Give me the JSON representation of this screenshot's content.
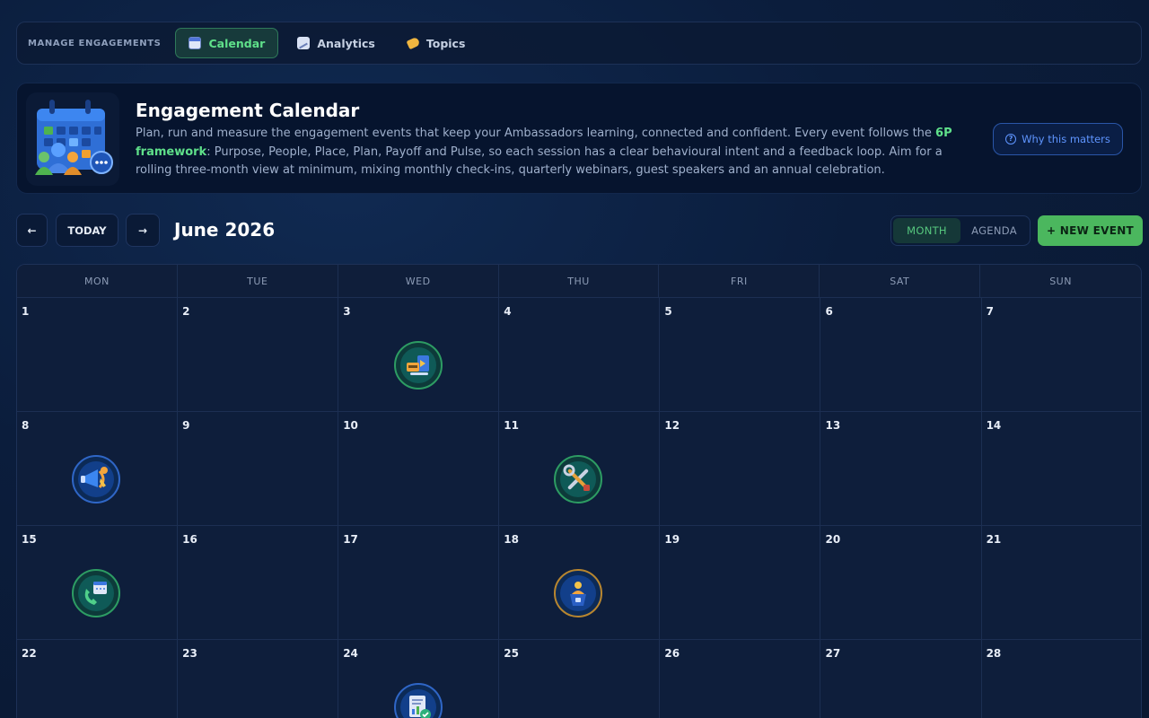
{
  "nav": {
    "title": "MANAGE ENGAGEMENTS",
    "tabs": [
      {
        "label": "Calendar",
        "icon": "calendar-icon",
        "active": true
      },
      {
        "label": "Analytics",
        "icon": "chart-icon",
        "active": false
      },
      {
        "label": "Topics",
        "icon": "tag-icon",
        "active": false
      }
    ]
  },
  "hero": {
    "title": "Engagement Calendar",
    "desc_before": "Plan, run and measure the engagement events that keep your Ambassadors learning, connected and confident. Every event follows the ",
    "desc_highlight": "6P framework",
    "desc_after": ": Purpose, People, Place, Plan, Payoff and Pulse, so each session has a clear behavioural intent and a feedback loop. Aim for a rolling three-month view at minimum, mixing monthly check-ins, quarterly webinars, guest speakers and an annual celebration.",
    "why_button": "Why this matters",
    "colors": {
      "highlight": "#5fe08a",
      "link": "#5f95ff"
    }
  },
  "controls": {
    "prev": "←",
    "today": "TODAY",
    "next": "→",
    "month_label": "June 2026",
    "views": [
      "MONTH",
      "AGENDA"
    ],
    "active_view": "MONTH",
    "new_event": "+ NEW EVENT"
  },
  "calendar": {
    "weekdays": [
      "MON",
      "TUE",
      "WED",
      "THU",
      "FRI",
      "SAT",
      "SUN"
    ],
    "weeks": [
      [
        "1",
        "2",
        "3",
        "4",
        "5",
        "6",
        "7"
      ],
      [
        "8",
        "9",
        "10",
        "11",
        "12",
        "13",
        "14"
      ],
      [
        "15",
        "16",
        "17",
        "18",
        "19",
        "20",
        "21"
      ],
      [
        "22",
        "23",
        "24",
        "25",
        "26",
        "27",
        "28"
      ]
    ],
    "events": [
      {
        "day": "3",
        "icon": "webinar-icon",
        "style": "green"
      },
      {
        "day": "8",
        "icon": "megaphone-icon",
        "style": "blue"
      },
      {
        "day": "11",
        "icon": "tools-icon",
        "style": "green"
      },
      {
        "day": "15",
        "icon": "phone-calendar-icon",
        "style": "green"
      },
      {
        "day": "18",
        "icon": "guest-speaker-icon",
        "style": "gold"
      },
      {
        "day": "24",
        "icon": "report-icon",
        "style": "blue"
      }
    ]
  }
}
